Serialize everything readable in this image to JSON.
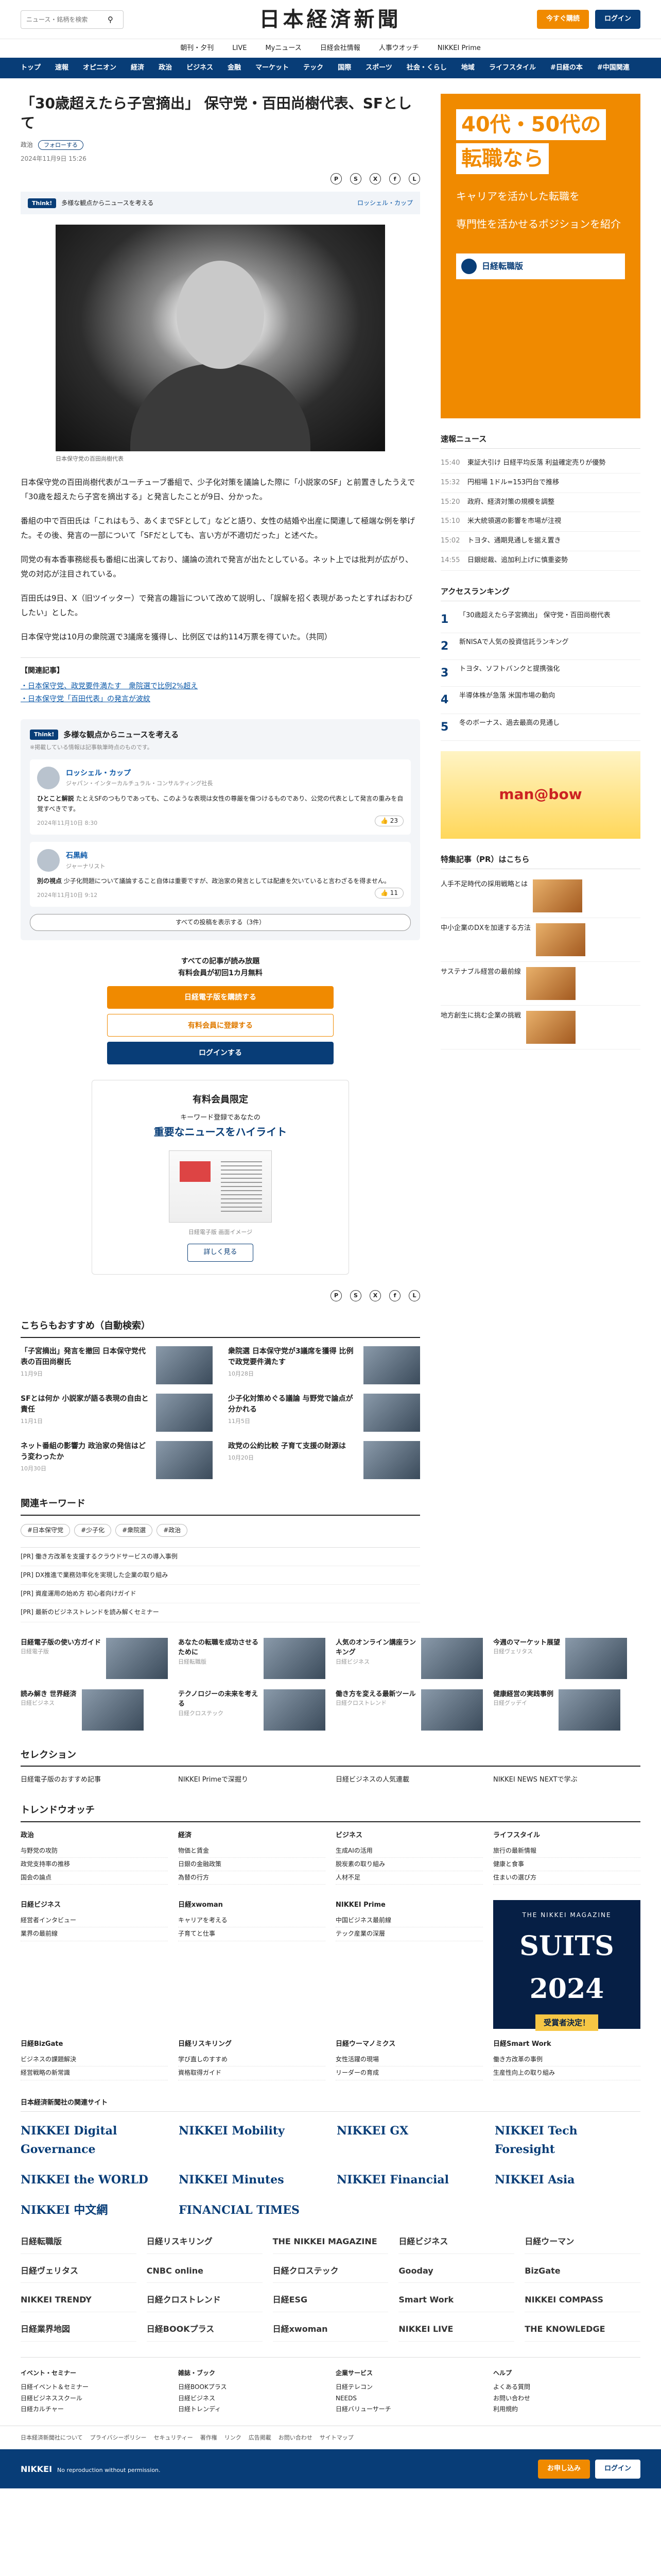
{
  "header": {
    "search_placeholder": "ニュース・銘柄を検索",
    "logo": "日本経済新聞",
    "trial_button": "今すぐ購読",
    "login_button": "ログイン",
    "subnav": [
      "朝刊・夕刊",
      "LIVE",
      "Myニュース",
      "日経会社情報",
      "人事ウオッチ",
      "NIKKEI Prime"
    ],
    "mainnav": [
      "トップ",
      "速報",
      "オピニオン",
      "経済",
      "政治",
      "ビジネス",
      "金融",
      "マーケット",
      "テック",
      "国際",
      "スポーツ",
      "社会・くらし",
      "地域",
      "ライフスタイル",
      "#日経の本",
      "#中国関連"
    ]
  },
  "article": {
    "title": "「30歳超えたら子宮摘出」 保守党・百田尚樹代表、SFとして",
    "section": "政治",
    "follow": "フォローする",
    "date": "2024年11月9日 15:26",
    "think_tag": "Think!",
    "think_bar_text": "多様な観点からニュースを考える",
    "think_bar_expert": "ロッシェル・カップ",
    "photo_caption": "日本保守党の百田尚樹代表",
    "paragraphs": [
      "日本保守党の百田尚樹代表がユーチューブ番組で、少子化対策を議論した際に「小説家のSF」と前置きしたうえで「30歳を超えたら子宮を摘出する」と発言したことが9日、分かった。",
      "番組の中で百田氏は「これはもう、あくまでSFとして」などと語り、女性の結婚や出産に関連して極端な例を挙げた。その後、発言の一部について「SFだとしても、言い方が不適切だった」と述べた。",
      "同党の有本香事務総長も番組に出演しており、議論の流れで発言が出たとしている。ネット上では批判が広がり、党の対応が注目されている。",
      "百田氏は9日、X（旧ツイッター）で発言の趣旨について改めて説明し、「誤解を招く表現があったとすればおわびしたい」とした。",
      "日本保守党は10月の衆院選で3議席を獲得し、比例区では約114万票を得ていた。（共同）"
    ],
    "related_title": "【関連記事】",
    "related": [
      "・日本保守党、政党要件満たす　衆院選で比例2%超え",
      "・日本保守党「百田代表」の発言が波紋"
    ]
  },
  "think": {
    "tag": "Think!",
    "title": "多様な観点からニュースを考える",
    "note": "※掲載している情報は記事執筆時点のものです。",
    "comments": [
      {
        "name": "ロッシェル・カップ",
        "role": "ジャパン・インターカルチュラル・コンサルティング社長",
        "label": "ひとこと解説",
        "text": "たとえSFのつもりであっても、このような表現は女性の尊厳を傷つけるものであり、公党の代表として発言の重みを自覚すべきです。",
        "date": "2024年11月10日 8:30",
        "likes": "23"
      },
      {
        "name": "石黒純",
        "role": "ジャーナリスト",
        "label": "別の視点",
        "text": "少子化問題について議論すること自体は重要ですが、政治家の発言としては配慮を欠いていると言わざるを得ません。",
        "date": "2024年11月10日 9:12",
        "likes": "11"
      }
    ],
    "more": "すべての投稿を表示する（3件）"
  },
  "paywall": {
    "line1": "すべての記事が読み放題",
    "line2": "有料会員が初回1カ月無料",
    "btn1": "日経電子版を購読する",
    "btn2": "有料会員に登録する",
    "btn3": "ログインする"
  },
  "member": {
    "title": "有料会員限定",
    "line": "キーワード登録であなたの",
    "highlight": "重要なニュースをハイライト",
    "image_caption": "日経電子版 画面イメージ",
    "button": "詳しく見る"
  },
  "recommend": {
    "title": "こちらもおすすめ（自動検索）",
    "items": [
      {
        "title": "「子宮摘出」発言を撤回 日本保守党代表の百田尚樹氏",
        "date": "11月9日"
      },
      {
        "title": "衆院選 日本保守党が3議席を獲得 比例で政党要件満たす",
        "date": "10月28日"
      },
      {
        "title": "SFとは何か 小説家が語る表現の自由と責任",
        "date": "11月1日"
      },
      {
        "title": "少子化対策めぐる議論 与野党で論点が分かれる",
        "date": "11月5日"
      },
      {
        "title": "ネット番組の影響力 政治家の発信はどう変わったか",
        "date": "10月30日"
      },
      {
        "title": "政党の公約比較 子育て支援の財源は",
        "date": "10月20日"
      }
    ]
  },
  "keywords": {
    "title": "関連キーワード",
    "items": [
      "#日本保守党",
      "#少子化",
      "#衆院選",
      "#政治"
    ]
  },
  "ad_list": [
    "[PR] 働き方改革を支援するクラウドサービスの導入事例",
    "[PR] DX推進で業務効率化を実現した企業の取り組み",
    "[PR] 資産運用の始め方 初心者向けガイド",
    "[PR] 最新のビジネストレンドを読み解くセミナー"
  ],
  "sidebar": {
    "ad_a": "40代・50代の",
    "ad_b": "転職なら",
    "ad_c": "キャリアを活かした転職を",
    "ad_d": "専門性を活かせるポジションを紹介",
    "ad_brand": "日経転職版",
    "news_title": "速報ニュース",
    "news": [
      {
        "time": "15:40",
        "text": "東証大引け 日経平均反落 利益確定売りが優勢"
      },
      {
        "time": "15:32",
        "text": "円相場 1ドル=153円台で推移"
      },
      {
        "time": "15:20",
        "text": "政府、経済対策の規模を調整"
      },
      {
        "time": "15:10",
        "text": "米大統領選の影響を市場が注視"
      },
      {
        "time": "15:02",
        "text": "トヨタ、通期見通しを据え置き"
      },
      {
        "time": "14:55",
        "text": "日銀総裁、追加利上げに慎重姿勢"
      }
    ],
    "rank_title": "アクセスランキング",
    "rank": [
      {
        "n": "1",
        "text": "「30歳超えたら子宮摘出」 保守党・百田尚樹代表"
      },
      {
        "n": "2",
        "text": "新NISAで人気の投資信託ランキング"
      },
      {
        "n": "3",
        "text": "トヨタ、ソフトバンクと提携強化"
      },
      {
        "n": "4",
        "text": "半導体株が急落 米国市場の動向"
      },
      {
        "n": "5",
        "text": "冬のボーナス、過去最高の見通し"
      }
    ],
    "side_ad": "man@bow",
    "pr_title": "特集記事（PR）はこちら",
    "pr": [
      "人手不足時代の採用戦略とは",
      "中小企業のDXを加速する方法",
      "サステナブル経営の最前線",
      "地方創生に挑む企業の挑戦"
    ]
  },
  "lower": {
    "picks": [
      {
        "title": "日経電子版の使い方ガイド",
        "src": "日経電子版"
      },
      {
        "title": "あなたの転職を成功させるために",
        "src": "日経転職版"
      },
      {
        "title": "人気のオンライン講座ランキング",
        "src": "日経ビジネス"
      },
      {
        "title": "今週のマーケット展望",
        "src": "日経ヴェリタス"
      },
      {
        "title": "読み解き 世界経済",
        "src": "日経ビジネス"
      },
      {
        "title": "テクノロジーの未来を考える",
        "src": "日経クロステック"
      },
      {
        "title": "働き方を変える最新ツール",
        "src": "日経クロストレンド"
      },
      {
        "title": "健康経営の実践事例",
        "src": "日経グッデイ"
      }
    ],
    "selection_title": "セレクション",
    "selection": [
      "日経電子版のおすすめ記事",
      "NIKKEI Primeで深掘り",
      "日経ビジネスの人気連載",
      "NIKKEI NEWS NEXTで学ぶ"
    ],
    "trend_title": "トレンドウオッチ",
    "trend_cols": [
      {
        "h": "政治",
        "items": [
          "与野党の攻防",
          "政党支持率の推移",
          "国会の論点"
        ]
      },
      {
        "h": "経済",
        "items": [
          "物価と賃金",
          "日銀の金融政策",
          "為替の行方"
        ]
      },
      {
        "h": "ビジネス",
        "items": [
          "生成AIの活用",
          "脱炭素の取り組み",
          "人材不足"
        ]
      },
      {
        "h": "ライフスタイル",
        "items": [
          "旅行の最新情報",
          "健康と食事",
          "住まいの選び方"
        ]
      }
    ],
    "suits_a": "THE NIKKEI MAGAZINE",
    "suits_b": "SUITS 2024",
    "suits_c": "受賞者決定！",
    "groups": [
      {
        "h": "日経ビジネス",
        "items": [
          "経営者インタビュー",
          "業界の最前線"
        ]
      },
      {
        "h": "日経xwoman",
        "items": [
          "キャリアを考える",
          "子育てと仕事"
        ]
      },
      {
        "h": "NIKKEI Prime",
        "items": [
          "中国ビジネス最前線",
          "テック産業の深層"
        ]
      },
      {
        "h": "日経BizGate",
        "items": [
          "ビジネスの課題解決",
          "経営戦略の新常識"
        ]
      },
      {
        "h": "日経リスキリング",
        "items": [
          "学び直しのすすめ",
          "資格取得ガイド"
        ]
      },
      {
        "h": "日経ウーマノミクス",
        "items": [
          "女性活躍の現場",
          "リーダーの育成"
        ]
      },
      {
        "h": "日経Smart Work",
        "items": [
          "働き方改革の事例",
          "生産性向上の取り組み"
        ]
      }
    ],
    "logos_title": "日本経済新聞社の関連サイト",
    "logos": [
      "NIKKEI Digital Governance",
      "NIKKEI Mobility",
      "NIKKEI GX",
      "NIKKEI Tech Foresight",
      "NIKKEI the WORLD",
      "NIKKEI Minutes",
      "NIKKEI Financial",
      "NIKKEI Asia",
      "NIKKEI 中文網",
      "FINANCIAL TIMES"
    ],
    "brands": [
      "日経転職版",
      "日経リスキリング",
      "THE NIKKEI MAGAZINE",
      "日経ビジネス",
      "日経ウーマン",
      "日経ヴェリタス",
      "CNBC online",
      "日経クロステック",
      "Gooday",
      "BizGate",
      "NIKKEI TRENDY",
      "日経クロストレンド",
      "日経ESG",
      "Smart Work",
      "NIKKEI COMPASS",
      "日経業界地図",
      "日経BOOKプラス",
      "日経xwoman",
      "NIKKEI LIVE",
      "THE KNOWLEDGE"
    ],
    "footer_cols": [
      {
        "h": "イベント・セミナー",
        "items": [
          "日経イベント＆セミナー",
          "日経ビジネススクール",
          "日経カルチャー"
        ]
      },
      {
        "h": "雑誌・ブック",
        "items": [
          "日経BOOKプラス",
          "日経ビジネス",
          "日経トレンディ"
        ]
      },
      {
        "h": "企業サービス",
        "items": [
          "日経テレコン",
          "NEEDS",
          "日経バリューサーチ"
        ]
      },
      {
        "h": "ヘルプ",
        "items": [
          "よくある質問",
          "お問い合わせ",
          "利用規約"
        ]
      }
    ],
    "bottom_links": [
      "日本経済新聞社について",
      "プライバシーポリシー",
      "セキュリティー",
      "著作権",
      "リンク",
      "広告掲載",
      "お問い合わせ",
      "サイトマップ"
    ],
    "footbar_logo": "NIKKEI",
    "footbar_note": "No reproduction without permission.",
    "footbar_btn1": "お申し込み",
    "footbar_btn2": "ログイン"
  },
  "colors": {
    "brand": "#083d77",
    "accent": "#f08a00"
  }
}
